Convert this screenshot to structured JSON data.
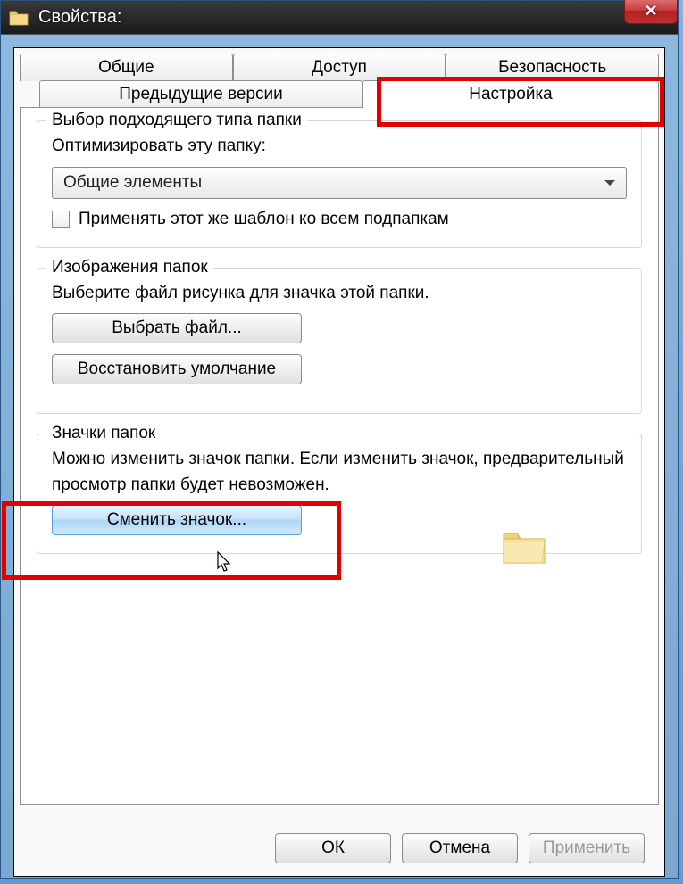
{
  "titlebar": {
    "title": "Свойства:"
  },
  "tabs": {
    "row1": [
      "Общие",
      "Доступ",
      "Безопасность"
    ],
    "row2": [
      "Предыдущие версии",
      "Настройка"
    ],
    "active": "Настройка"
  },
  "section_folder_type": {
    "title": "Выбор подходящего типа папки",
    "optimize_label": "Оптимизировать эту папку:",
    "dropdown_value": "Общие элементы",
    "checkbox_label": "Применять этот же шаблон ко всем подпапкам"
  },
  "section_folder_images": {
    "title": "Изображения папок",
    "description": "Выберите файл рисунка для значка этой папки.",
    "choose_file_btn": "Выбрать файл...",
    "restore_default_btn": "Восстановить умолчание"
  },
  "section_folder_icons": {
    "title": "Значки папок",
    "description": "Можно изменить значок папки. Если изменить значок, предварительный просмотр папки будет невозможен.",
    "change_icon_btn": "Сменить значок..."
  },
  "bottom": {
    "ok": "ОК",
    "cancel": "Отмена",
    "apply": "Применить"
  }
}
